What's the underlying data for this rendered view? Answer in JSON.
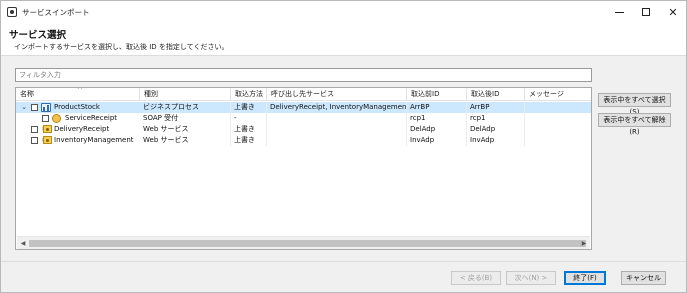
{
  "window": {
    "title": "サービスインポート"
  },
  "header": {
    "title": "サービス選択",
    "description": "インポートするサービスを選択し、取込後 ID を指定してください。"
  },
  "filter": {
    "placeholder": "フィルタ入力"
  },
  "table": {
    "columns": [
      "名称",
      "種別",
      "取込方法",
      "呼び出し先サービス",
      "取込前ID",
      "取込後ID",
      "メッセージ"
    ],
    "rows": [
      {
        "name": "ProductStock",
        "type": "ビジネスプロセス",
        "method": "上書き",
        "callee": "DeliveryReceipt, InventoryManagement",
        "before_id": "ArrBP",
        "after_id": "ArrBP",
        "message": "",
        "expander": "⌄",
        "icon": "business-process-icon"
      },
      {
        "name": "ServiceReceipt",
        "type": "SOAP 受付",
        "method": "-",
        "callee": "",
        "before_id": "rcp1",
        "after_id": "rcp1",
        "message": "",
        "icon": "soap-receiver-icon"
      },
      {
        "name": "DeliveryReceipt",
        "type": "Web サービス",
        "method": "上書き",
        "callee": "",
        "before_id": "DelAdp",
        "after_id": "DelAdp",
        "message": "",
        "expander": "›",
        "icon": "web-service-icon"
      },
      {
        "name": "InventoryManagement",
        "type": "Web サービス",
        "method": "上書き",
        "callee": "",
        "before_id": "InvAdp",
        "after_id": "InvAdp",
        "message": "",
        "expander": "›",
        "icon": "web-service-icon"
      }
    ]
  },
  "side_buttons": {
    "select_all": "表示中をすべて選択(S)",
    "deselect_all": "表示中をすべて解除(R)"
  },
  "footer": {
    "back": "< 戻る(B)",
    "next": "次へ(N) >",
    "finish": "終了(F)",
    "cancel": "キャンセル"
  },
  "colors": {
    "selection": "#cce8ff",
    "primary_border": "#0078d7"
  }
}
